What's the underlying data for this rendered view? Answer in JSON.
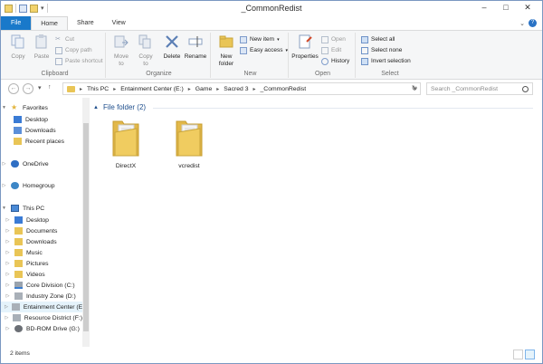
{
  "window": {
    "title": "_CommonRedist",
    "controls": [
      "–",
      "□",
      "✕"
    ]
  },
  "tabs": [
    {
      "label": "File"
    },
    {
      "label": "Home"
    },
    {
      "label": "Share"
    },
    {
      "label": "View"
    }
  ],
  "ribbon": {
    "clipboard": {
      "label": "Clipboard",
      "copy": "Copy",
      "paste": "Paste",
      "cut": "Cut",
      "copy_path": "Copy path",
      "paste_shortcut": "Paste shortcut"
    },
    "organize": {
      "label": "Organize",
      "move_to": "Move",
      "move_to_2": "to",
      "copy_to": "Copy",
      "copy_to_2": "to",
      "delete": "Delete",
      "rename": "Rename"
    },
    "new": {
      "label": "New",
      "new_folder": "New",
      "new_folder_2": "folder",
      "new_item": "New item",
      "easy_access": "Easy access"
    },
    "open": {
      "label": "Open",
      "properties": "Properties",
      "open": "Open",
      "edit": "Edit",
      "history": "History"
    },
    "select": {
      "label": "Select",
      "select_all": "Select all",
      "select_none": "Select none",
      "invert_selection": "Invert selection"
    }
  },
  "address": {
    "crumbs": [
      "This PC",
      "Entainment Center (E:)",
      "Game",
      "Sacred 3",
      "_CommonRedist"
    ],
    "search_placeholder": "Search _CommonRedist"
  },
  "nav": {
    "items": [
      {
        "label": "Favorites"
      },
      {
        "label": "Desktop"
      },
      {
        "label": "Downloads"
      },
      {
        "label": "Recent places"
      },
      {
        "label": "OneDrive"
      },
      {
        "label": "Homegroup"
      },
      {
        "label": "This PC"
      },
      {
        "label": "Desktop"
      },
      {
        "label": "Documents"
      },
      {
        "label": "Downloads"
      },
      {
        "label": "Music"
      },
      {
        "label": "Pictures"
      },
      {
        "label": "Videos"
      },
      {
        "label": "Core Division (C:)"
      },
      {
        "label": "Industry Zone (D:)"
      },
      {
        "label": "Entainment Center (E:)"
      },
      {
        "label": "Resource District (F:)"
      },
      {
        "label": "BD-ROM Drive (G:)"
      }
    ]
  },
  "content": {
    "group_header": "File folder (2)",
    "items": [
      {
        "name": "DirectX"
      },
      {
        "name": "vcredist"
      }
    ]
  },
  "status": {
    "item_count": "2 items"
  },
  "colors": {
    "file_tab": "#1979ca",
    "folder": "#e9c556",
    "selection": "#e5f3fb",
    "group_header": "#1e4e8c"
  }
}
